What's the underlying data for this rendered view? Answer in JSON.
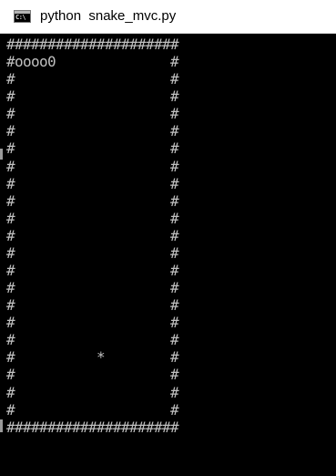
{
  "window": {
    "title": "python  snake_mvc.py",
    "icon": "cmd-console-icon",
    "icon_text": "C:\\",
    "colors": {
      "titlebar_bg": "#ffffff",
      "console_bg": "#000000",
      "console_fg": "#c0c0c0"
    }
  },
  "console": {
    "lines": [
      "#####################",
      "#oooo0              #",
      "#                   #",
      "#                   #",
      "#                   #",
      "#                   #",
      "#                   #",
      "#                   #",
      "#                   #",
      "#                   #",
      "#                   #",
      "#                   #",
      "#                   #",
      "#                   #",
      "#                   #",
      "#                   #",
      "#                   #",
      "#                   #",
      "#          *        #",
      "#                   #",
      "#                   #",
      "#                   #",
      "#####################"
    ]
  }
}
